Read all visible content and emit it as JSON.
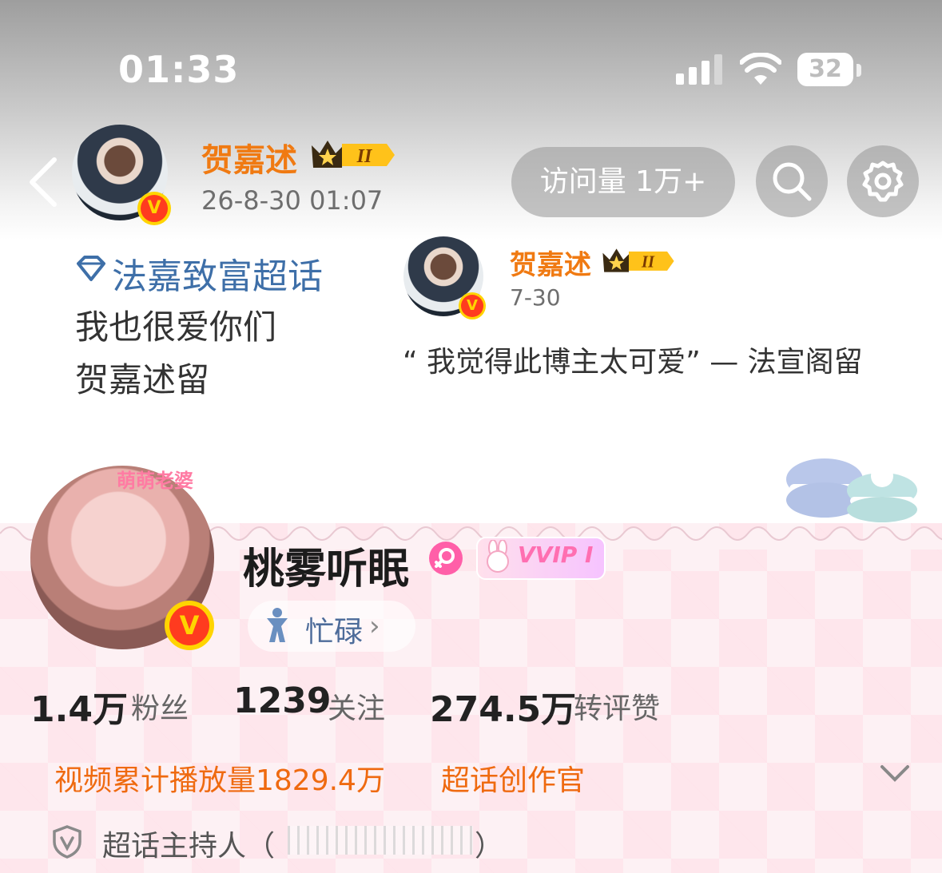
{
  "status_bar": {
    "time": "01:33",
    "battery": "32"
  },
  "header": {
    "user_name": "贺嘉述",
    "level_badge": "II",
    "post_time": "26-8-30 01:07",
    "visits_label": "访问量 1万+"
  },
  "intro": {
    "topic": "法嘉致富超话",
    "line1": "我也很爱你们",
    "line2": "贺嘉述留"
  },
  "comment_card": {
    "user_name": "贺嘉述",
    "level_badge": "II",
    "date": "7-30",
    "quote": "“ 我觉得此博主太可爱” — 法宣阁留"
  },
  "profile": {
    "avatar_tag": "萌萌老婆",
    "username": "桃雾听眠",
    "vip_badge": "VVIP I",
    "status": "忙碌",
    "stats": [
      {
        "value": "1.4万",
        "label": "粉丝"
      },
      {
        "value": "1239",
        "label": "关注"
      },
      {
        "value": "274.5万",
        "label": "转评赞"
      }
    ],
    "video_plays": "视频累计播放量1829.4万",
    "creator_title": "超话创作官",
    "host_label": "超话主持人（",
    "host_close": "）"
  },
  "colors": {
    "accent_orange": "#f07a12",
    "link_blue": "#3e6fa8",
    "pink": "#ff5fa8"
  }
}
